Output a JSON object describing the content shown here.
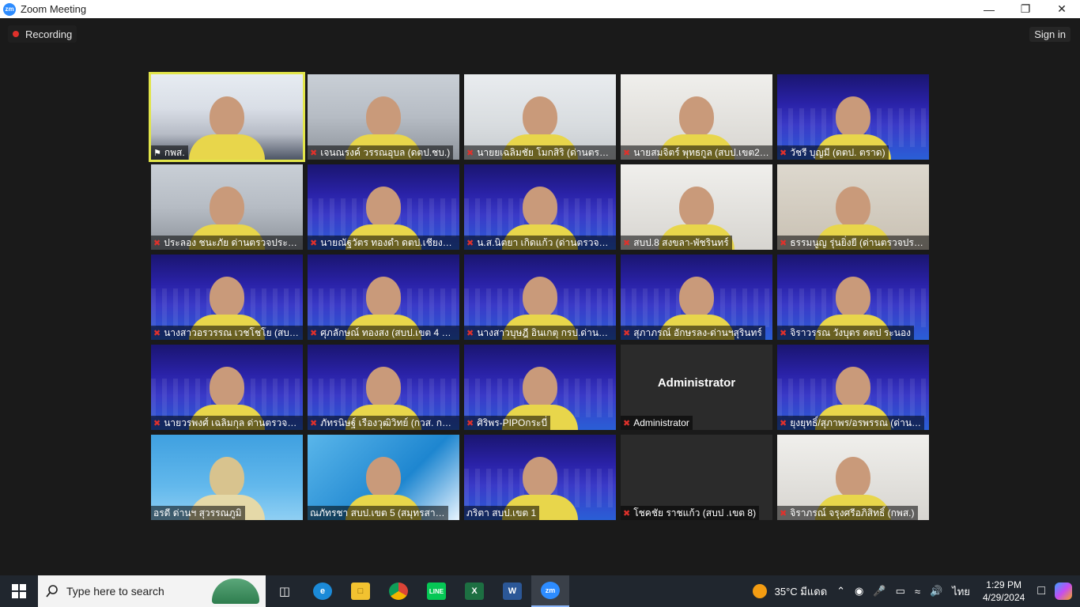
{
  "window": {
    "title": "Zoom Meeting",
    "logo": "zm"
  },
  "toolbar": {
    "recording_label": "Recording",
    "signin_label": "Sign in"
  },
  "participants": [
    {
      "name": "กพส.",
      "bg": "room",
      "active": true,
      "muted": false,
      "pinned": true
    },
    {
      "name": "เจนณรงค์ วรรณอุบล (ดตป.ชบ.)",
      "bg": "office",
      "muted": true
    },
    {
      "name": "นายยเฉลิมชัย โมกสิริ (ด่านตรว…",
      "bg": "white",
      "muted": true
    },
    {
      "name": "นายสมจิตร์ พุทธกูล (สบป.เขต2(…",
      "bg": "light",
      "muted": true
    },
    {
      "name": "วัชรี บุญมี  (ดตป. ตราด)",
      "bg": "blue",
      "muted": true
    },
    {
      "name": "ประลอง ชนะภัย ด่านตรวจประมง…",
      "bg": "office",
      "muted": true
    },
    {
      "name": "นายณัฐวัตร ทองดำ ดตป.เชียงใหม่",
      "bg": "blue",
      "muted": true
    },
    {
      "name": "น.ส.นิตยา เกิดแก้ว (ด่านตรวจปร…",
      "bg": "blue",
      "muted": true
    },
    {
      "name": "สบป.8 สงขลา-พัชรินทร์",
      "bg": "light",
      "muted": true
    },
    {
      "name": "ธรรมนูญ รุ่นยิ่งยี (ด่านตรวจประ…",
      "bg": "wall",
      "muted": true
    },
    {
      "name": "นางสาวอรวรรณ เวชโชโย (สบป …",
      "bg": "blue",
      "muted": true
    },
    {
      "name": "ศุภลักษณ์ ทองสง (สบป.เขต 4 ส…",
      "bg": "blue",
      "muted": true
    },
    {
      "name": "นางสาวบุษฎี อินเกตุ กรป.ด่านตร…",
      "bg": "blue",
      "muted": true
    },
    {
      "name": "สุภาภรณ์ อักษรลง-ด่านฯสุรินทร์",
      "bg": "blue",
      "muted": true
    },
    {
      "name": "จิราวรรณ วังบุตร ดตป ระนอง",
      "bg": "blue",
      "muted": true
    },
    {
      "name": "นายวรพงศ์ เฉลิมกุล ด่านตรวจป…",
      "bg": "blue",
      "muted": true
    },
    {
      "name": "ภัทรนิษฐ์ เรืองวุฒิวิทย์ (กวส. กร…",
      "bg": "blue",
      "muted": true
    },
    {
      "name": "ศิริพร-PIPOกระบี่",
      "bg": "blue",
      "muted": true
    },
    {
      "name": "Administrator",
      "bg": "black",
      "muted": true,
      "center_text": "Administrator"
    },
    {
      "name": "ยุงยุทธิ์/สุภาพร/อรพรรณ (ด่าน…",
      "bg": "blue",
      "muted": true
    },
    {
      "name": "อรดี ด่านฯ สุวรรณภูมิ",
      "bg": "sky",
      "muted": false
    },
    {
      "name": "ณภัทรชา สบป.เขต 5 (สมุทรสา…",
      "bg": "sky2",
      "muted": false
    },
    {
      "name": "ภริตา สบป.เขต 1",
      "bg": "blue",
      "muted": false
    },
    {
      "name": "โชคชัย ราชแก้ว (สบป .เขต 8)",
      "bg": "black",
      "muted": true
    },
    {
      "name": "จิราภรณ์ จรุงศรีอภิสิทธิ์ (กพส.)",
      "bg": "light",
      "muted": true
    }
  ],
  "taskbar": {
    "search_placeholder": "Type here to search",
    "weather": "35°C  มีแดด",
    "lang": "ไทย",
    "time": "1:29 PM",
    "date": "4/29/2024",
    "apps": [
      "task-view",
      "edge",
      "file-explorer",
      "chrome",
      "line",
      "excel",
      "word",
      "zoom"
    ]
  }
}
